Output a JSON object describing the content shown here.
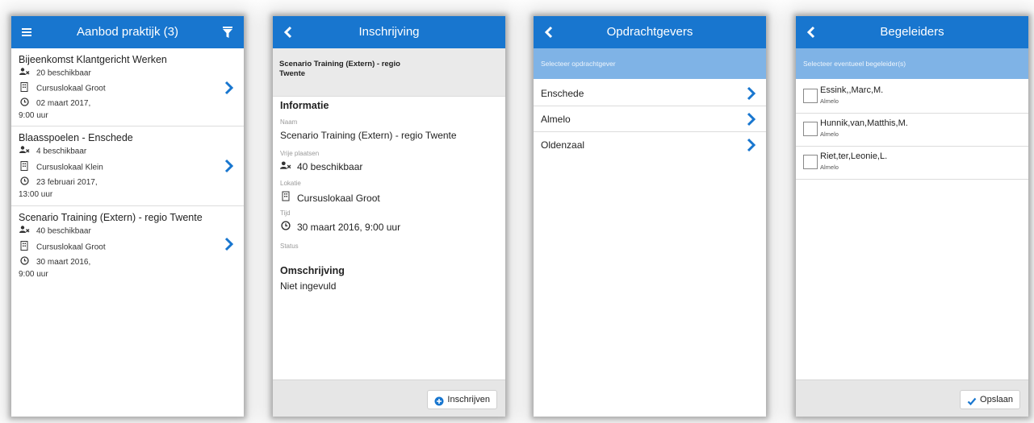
{
  "screen1": {
    "title": "Aanbod praktijk (3)",
    "items": [
      {
        "name": "Bijeenkomst Klantgericht Werken",
        "spots": "20 beschikbaar",
        "location": "Cursuslokaal Groot",
        "date": "02 maart 2017,",
        "time": "9:00 uur"
      },
      {
        "name": "Blaasspoelen - Enschede",
        "spots": "4 beschikbaar",
        "location": "Cursuslokaal Klein",
        "date": "23 februari 2017,",
        "time": "13:00 uur"
      },
      {
        "name": "Scenario Training (Extern) - regio Twente",
        "spots": "40 beschikbaar",
        "location": "Cursuslokaal Groot",
        "date": "30 maart 2016,",
        "time": "9:00 uur"
      }
    ]
  },
  "screen2": {
    "title": "Inschrijving",
    "header_line1": "Scenario Training (Extern) - regio",
    "header_line2": "Twente",
    "info_heading": "Informatie",
    "name_label": "Naam",
    "name_value": "Scenario Training (Extern) - regio Twente",
    "spots_label": "Vrije plaatsen",
    "spots_value": "40 beschikbaar",
    "location_label": "Lokatie",
    "location_value": "Cursuslokaal Groot",
    "time_label": "Tijd",
    "time_value": "30 maart 2016, 9:00 uur",
    "status_label": "Status",
    "desc_heading": "Omschrijving",
    "desc_value": "Niet ingevuld",
    "button_label": "Inschrijven"
  },
  "screen3": {
    "title": "Opdrachtgevers",
    "subheader": "Selecteer opdrachtgever",
    "items": [
      "Enschede",
      "Almelo",
      "Oldenzaal"
    ]
  },
  "screen4": {
    "title": "Begeleiders",
    "subheader": "Selecteer eventueel begeleider(s)",
    "items": [
      {
        "name": "Essink,,Marc,M.",
        "city": "Almelo"
      },
      {
        "name": "Hunnik,van,Matthis,M.",
        "city": "Almelo"
      },
      {
        "name": "Riet,ter,Leonie,L.",
        "city": "Almelo"
      }
    ],
    "button_label": "Opslaan"
  },
  "colors": {
    "primary": "#1876cf",
    "subheader": "#7fb3e6",
    "footer": "#e6e6e6"
  },
  "icons": [
    "menu-icon",
    "filter-icon",
    "back-icon",
    "chevron-right-icon",
    "users-icon",
    "building-icon",
    "clock-icon",
    "plus-circle-icon",
    "check-icon"
  ]
}
